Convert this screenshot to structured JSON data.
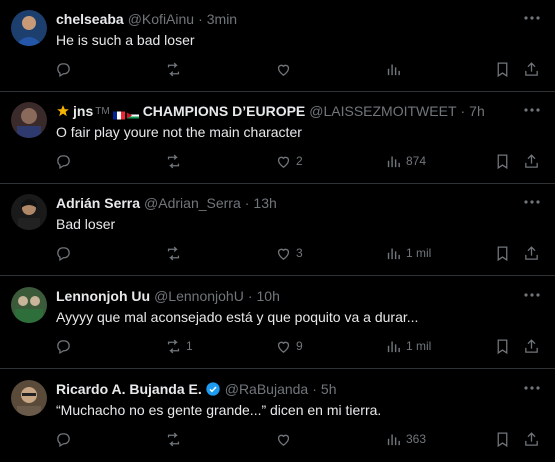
{
  "tweets": [
    {
      "name": "chelseaba",
      "handle": "@KofiAinu",
      "time": "3min",
      "text": "He is such a bad loser",
      "stats": {
        "replies": "",
        "retweets": "",
        "likes": "",
        "views": ""
      },
      "verified": false
    },
    {
      "name_prefix": "jns",
      "name_badge": "TM",
      "name": "CHAMPIONS D’EUROPE",
      "handle": "@LAISSEZMOITWEET",
      "time": "7h",
      "text": "O fair play youre not the main character",
      "stats": {
        "replies": "",
        "retweets": "",
        "likes": "2",
        "views": "874"
      },
      "verified": false
    },
    {
      "name": "Adrián Serra",
      "handle": "@Adrian_Serra",
      "time": "13h",
      "text": "Bad loser",
      "stats": {
        "replies": "",
        "retweets": "",
        "likes": "3",
        "views": "1 mil"
      },
      "verified": false
    },
    {
      "name": "Lennonjoh Uu",
      "handle": "@LennonjohU",
      "time": "10h",
      "text": "Ayyyy que mal aconsejado está y que poquito va a durar...",
      "stats": {
        "replies": "",
        "retweets": "1",
        "likes": "9",
        "views": "1 mil"
      },
      "verified": false
    },
    {
      "name": "Ricardo A. Bujanda E.",
      "handle": "@RaBujanda",
      "time": "5h",
      "text": "“Muchacho no es gente grande...” dicen en mi tierra.",
      "stats": {
        "replies": "",
        "retweets": "",
        "likes": "",
        "views": "363"
      },
      "verified": true
    }
  ],
  "separator": "·",
  "colors": {
    "background": "#000000",
    "text": "#e7e9ea",
    "muted": "#71767b",
    "border": "#2f3336",
    "verified": "#1d9bf0"
  },
  "icons": [
    "reply-icon",
    "retweet-icon",
    "like-icon",
    "views-icon",
    "bookmark-icon",
    "share-icon",
    "more-icon",
    "verified-icon"
  ]
}
